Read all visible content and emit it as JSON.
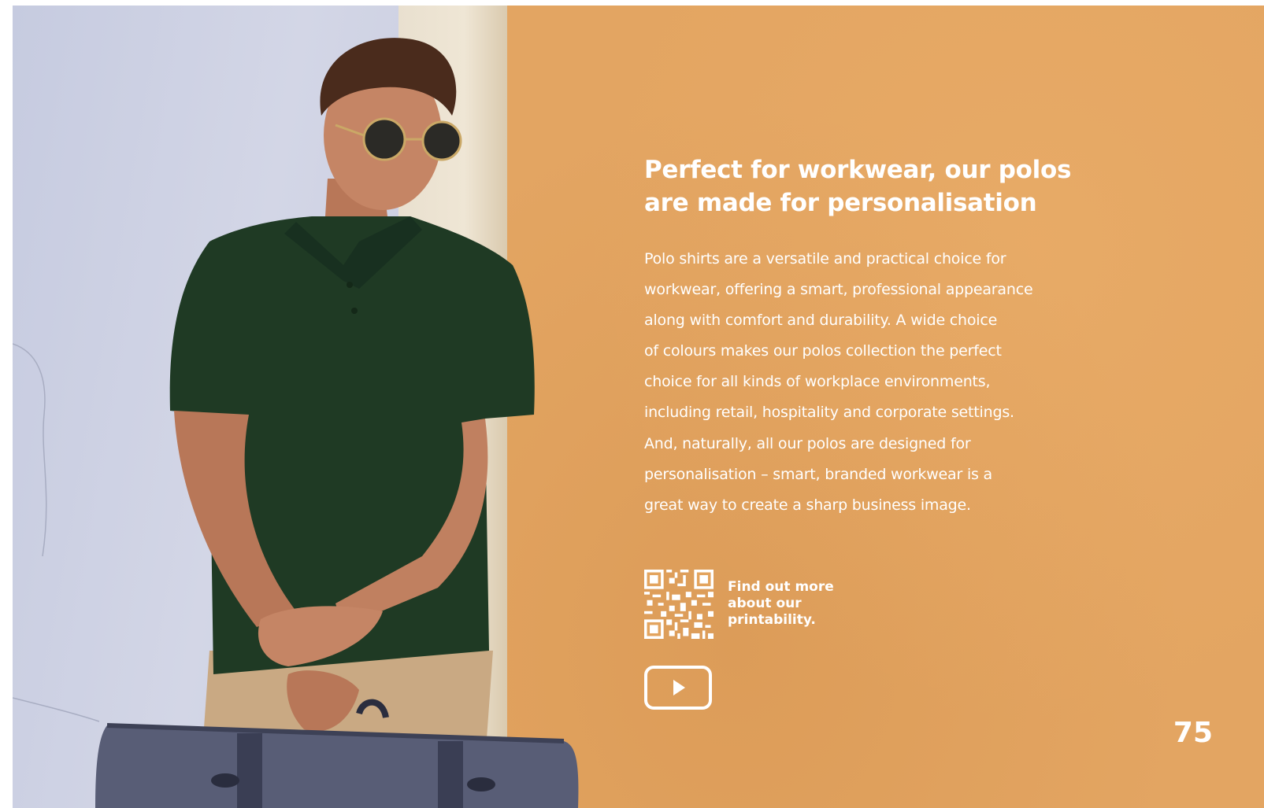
{
  "headline": {
    "line1": "Perfect for workwear, our polos",
    "line2": "are made for personalisation"
  },
  "body": {
    "lines": [
      "Polo shirts are a versatile and practical choice for",
      "workwear, offering a smart, professional appearance",
      "along with comfort and durability. A wide choice",
      "of colours makes our polos collection the perfect",
      "choice for all kinds of workplace environments,",
      "including retail, hospitality and corporate settings.",
      "And, naturally, all our polos are designed for",
      "personalisation – smart, branded workwear is a",
      "great way to create a sharp business image."
    ]
  },
  "qr_caption": {
    "line1": "Find out more",
    "line2": "about our",
    "line3": "printability."
  },
  "page_number": "75",
  "colors": {
    "background_orange": "#e3a45e",
    "text": "#ffffff",
    "polo_green": "#1f3a24"
  },
  "icons": {
    "qr": "qr-code-icon",
    "video": "play-video-icon"
  }
}
